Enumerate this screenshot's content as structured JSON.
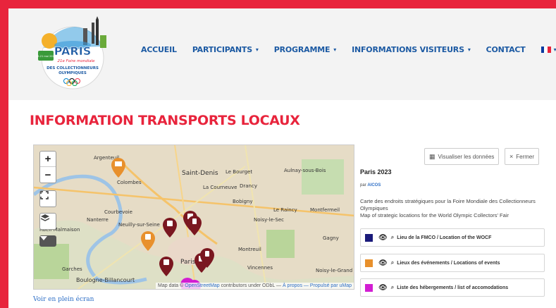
{
  "nav": {
    "items": [
      {
        "label": "ACCUEIL",
        "has_caret": false
      },
      {
        "label": "PARTICIPANTS",
        "has_caret": true
      },
      {
        "label": "PROGRAMME",
        "has_caret": true
      },
      {
        "label": "INFORMATIONS VISITEURS",
        "has_caret": true
      },
      {
        "label": "CONTACT",
        "has_caret": false
      }
    ],
    "caret_icon": "▾",
    "language": {
      "icon": "flag-fr-icon",
      "caret": "▾"
    }
  },
  "logo": {
    "title": "PARIS",
    "subtitle": "21e Foire mondiale",
    "line1": "DES COLLECTIONNEURS",
    "line2": "OLYMPIQUES",
    "dates": "19-21 mai 2023"
  },
  "page": {
    "title": "INFORMATION TRANSPORTS LOCAUX"
  },
  "map": {
    "zoom_in": "+",
    "zoom_out": "−",
    "place_labels": [
      "Argenteuil",
      "Saint-Denis",
      "Le Bourget",
      "Aulnay-sous-Bois",
      "Colombes",
      "La Courneuve",
      "Drancy",
      "Nanterre",
      "Courbevoie",
      "Bobigny",
      "Le Raincy",
      "Montfermeil",
      "Rueil-Malmaison",
      "Neuilly-sur-Seine",
      "Noisy-le-Sec",
      "Gagny",
      "Montreuil",
      "Paris",
      "Vincennes",
      "Garches",
      "Boulogne-Billancourt",
      "Noisy-le-Grand"
    ],
    "attribution": {
      "prefix": "Map data ©",
      "osm": "OpenStreetMap",
      "middle": "contributors under ODbL —",
      "credit": "À propos — Propulsé par uMap"
    },
    "fullscreen_link": "Voir en plein écran"
  },
  "panel": {
    "view_data_label": "Visualiser les données",
    "close_label": "Fermer",
    "title": "Paris 2023",
    "by_label": "par",
    "author": "AICOS",
    "description_fr": "Carte des endroits stratégiques pour la Foire Mondiale des Collectionneurs Olympiques",
    "description_en": "Map of strategic locations for the World Olympic Collectors' Fair",
    "layers": [
      {
        "label": "Lieu de la FMCO / Location of the WOCF",
        "color": "#1a1a7a"
      },
      {
        "label": "Lieux des événements / Locations of events",
        "color": "#e8902c"
      },
      {
        "label": "Liste des hébergements / list of accomodations",
        "color": "#d21ed2"
      }
    ]
  },
  "colors": {
    "accent_red": "#e8243c",
    "nav_blue": "#1c5aa3",
    "marker_darkred": "#7a1720",
    "marker_orange": "#e8902c"
  }
}
